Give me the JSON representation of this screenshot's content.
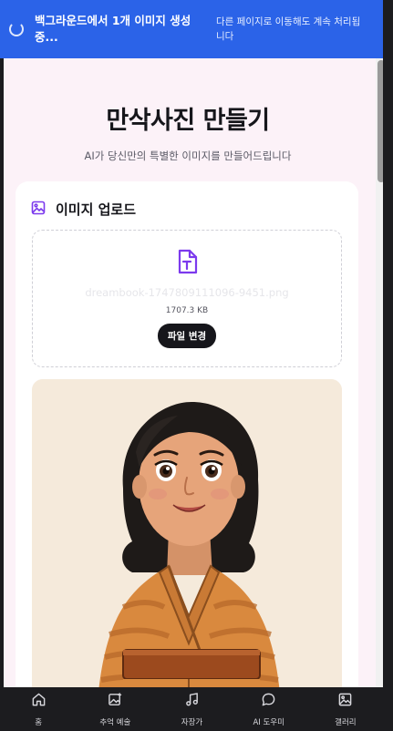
{
  "banner": {
    "status": "백그라운드에서 1개 이미지 생성 중...",
    "note": "다른 페이지로 이동해도 계속 처리됩니다"
  },
  "hero": {
    "title": "만삭사진 만들기",
    "subtitle": "AI가 당신만의 특별한 이미지를 만들어드립니다"
  },
  "upload": {
    "title": "이미지 업로드",
    "file_name": "dreambook-1747809111096-9451.png",
    "file_size": "1707.3 KB",
    "change_label": "파일 변경"
  },
  "colors": {
    "banner": "#2b63e8",
    "accent_purple": "#7c3aed",
    "background": "#fcf2f8"
  },
  "nav": {
    "items": [
      {
        "label": "홈",
        "icon": "home-icon"
      },
      {
        "label": "추억 예술",
        "icon": "image-plus-icon"
      },
      {
        "label": "자장가",
        "icon": "music-note-icon"
      },
      {
        "label": "AI 도우미",
        "icon": "chat-bubble-icon"
      },
      {
        "label": "갤러리",
        "icon": "gallery-icon"
      }
    ]
  }
}
